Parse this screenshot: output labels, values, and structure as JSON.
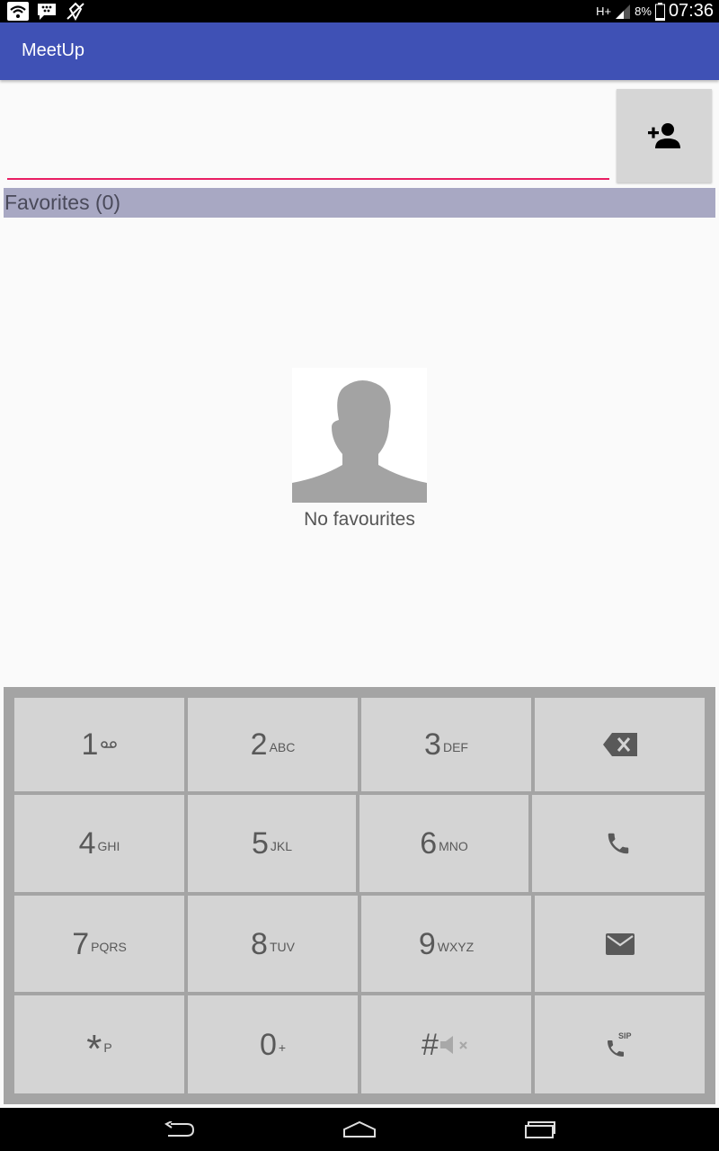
{
  "status_bar": {
    "battery_text": "8%",
    "time": "07:36",
    "network": "H+"
  },
  "app_bar": {
    "title": "MeetUp"
  },
  "search": {
    "value": "",
    "placeholder": ""
  },
  "favorites": {
    "header": "Favorites (0)",
    "empty_text": "No favourites"
  },
  "dialpad": {
    "keys": [
      {
        "digit": "1",
        "letters": ""
      },
      {
        "digit": "2",
        "letters": "ABC"
      },
      {
        "digit": "3",
        "letters": "DEF"
      },
      {
        "digit": "4",
        "letters": "GHI"
      },
      {
        "digit": "5",
        "letters": "JKL"
      },
      {
        "digit": "6",
        "letters": "MNO"
      },
      {
        "digit": "7",
        "letters": "PQRS"
      },
      {
        "digit": "8",
        "letters": "TUV"
      },
      {
        "digit": "9",
        "letters": "WXYZ"
      },
      {
        "digit": "*",
        "letters": "P"
      },
      {
        "digit": "0",
        "letters": "+"
      },
      {
        "digit": "#",
        "letters": ""
      }
    ],
    "action_icons": [
      "backspace-icon",
      "phone-icon",
      "email-icon",
      "sip-call-icon"
    ]
  },
  "colors": {
    "primary": "#3f51b5",
    "accent": "#e91e63",
    "header_bg": "#a8a8c3",
    "key_bg": "#d4d4d4",
    "key_text": "#595959"
  }
}
